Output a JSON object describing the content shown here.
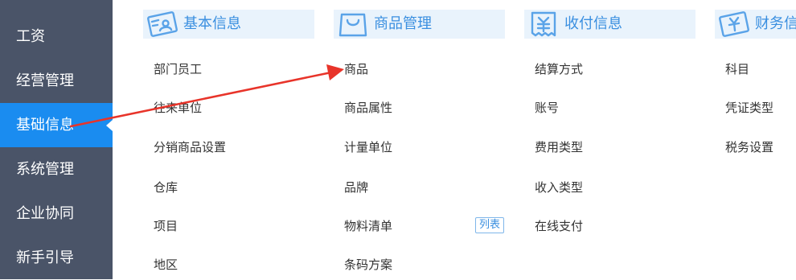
{
  "sidebar": {
    "items": [
      {
        "label": "工资",
        "active": false
      },
      {
        "label": "经营管理",
        "active": false
      },
      {
        "label": "基础信息",
        "active": true
      },
      {
        "label": "系统管理",
        "active": false
      },
      {
        "label": "企业协同",
        "active": false
      },
      {
        "label": "新手引导",
        "active": false
      }
    ]
  },
  "columns": [
    {
      "title": "基本信息",
      "icon": "id-card-icon",
      "items": [
        "部门员工",
        "往来单位",
        "分销商品设置",
        "仓库",
        "项目",
        "地区"
      ]
    },
    {
      "title": "商品管理",
      "icon": "shopping-bag-icon",
      "items": [
        "商品",
        "商品属性",
        "计量单位",
        "品牌",
        "物料清单",
        "条码方案"
      ],
      "badge": {
        "item_index": 4,
        "label": "列表"
      }
    },
    {
      "title": "收付信息",
      "icon": "receipt-icon",
      "items": [
        "结算方式",
        "账号",
        "费用类型",
        "收入类型",
        "在线支付"
      ]
    },
    {
      "title": "财务信",
      "icon": "yen-card-icon",
      "items": [
        "科目",
        "凭证类型",
        "税务设置"
      ]
    }
  ],
  "annotation": {
    "type": "red-arrow",
    "color": "#e8342a",
    "from": "基础信息",
    "to": "商品"
  },
  "colors": {
    "sidebar_bg": "#4a5468",
    "sidebar_active": "#1a8cf0",
    "header_bg": "#e9f3fc",
    "accent": "#3a8fe0",
    "text": "#333333"
  }
}
